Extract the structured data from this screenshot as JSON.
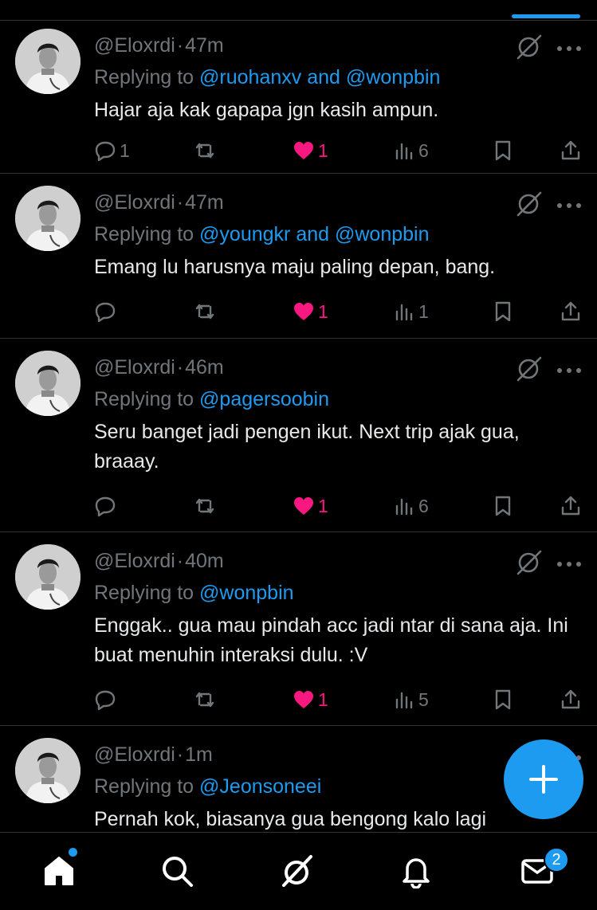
{
  "tweets": [
    {
      "handle": "@Eloxrdi",
      "time": "47m",
      "replying_prefix": "Replying to",
      "mentions": [
        "@ruohanxv",
        "@wonpbin"
      ],
      "text": "Hajar aja kak gapapa jgn kasih ampun.",
      "replies": "1",
      "likes": "1",
      "views": "6"
    },
    {
      "handle": "@Eloxrdi",
      "time": "47m",
      "replying_prefix": "Replying to",
      "mentions": [
        "@youngkr",
        "@wonpbin"
      ],
      "text": "Emang lu harusnya maju paling depan, bang.",
      "replies": "",
      "likes": "1",
      "views": "1"
    },
    {
      "handle": "@Eloxrdi",
      "time": "46m",
      "replying_prefix": "Replying to",
      "mentions": [
        "@pagersoobin"
      ],
      "text": "Seru banget jadi pengen ikut. Next trip ajak gua, braaay.",
      "replies": "",
      "likes": "1",
      "views": "6"
    },
    {
      "handle": "@Eloxrdi",
      "time": "40m",
      "replying_prefix": "Replying to",
      "mentions": [
        "@wonpbin"
      ],
      "text": "Enggak.. gua mau pindah acc jadi ntar di sana aja. Ini buat menuhin interaksi dulu. :V",
      "replies": "",
      "likes": "1",
      "views": "5"
    },
    {
      "handle": "@Eloxrdi",
      "time": "1m",
      "replying_prefix": "Replying to",
      "mentions": [
        "@Jeonsoneei"
      ],
      "text": "Pernah kok, biasanya gua bengong kalo lagi",
      "replies": "",
      "likes": "",
      "views": ""
    }
  ],
  "mention_joiner": "and",
  "nav": {
    "message_badge": "2"
  },
  "colors": {
    "accent": "#1d9bf0",
    "like": "#f91880",
    "muted": "#71767b",
    "text": "#e7e9ea",
    "divider": "#2f3336"
  }
}
